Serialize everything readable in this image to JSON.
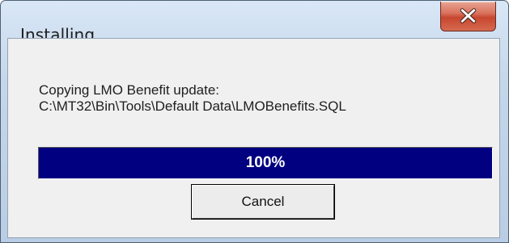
{
  "window": {
    "title": "Installing"
  },
  "titlebar": {
    "close_icon": "close-x-icon",
    "close_color": "#c7472f"
  },
  "message": {
    "line1": "Copying LMO Benefit update:",
    "line2": "C:\\MT32\\Bin\\Tools\\Default Data\\LMOBenefits.SQL"
  },
  "progress": {
    "percent": 100,
    "label": "100%",
    "fill_color": "#000080"
  },
  "buttons": {
    "cancel_label": "Cancel"
  }
}
